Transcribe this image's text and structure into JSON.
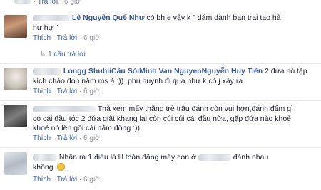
{
  "comments": [
    {
      "meta": {
        "reply_label": "Trả lời",
        "time": "6 giờ"
      }
    },
    {
      "author": "Lê Nguyễn Quế Như",
      "text_line1": " có bh e vậy k \" dám dành bạn trai tao hả",
      "text_line2": "hự hự \"",
      "meta": {
        "like_label": "Thích",
        "reply_label": "Trả lời",
        "time": "6 giờ"
      },
      "replies_label": "1 câu trả lời"
    },
    {
      "author": "Longg ShubiiCâu SóiMinh Van NguyenNguyễn Huy Tiến",
      "text_line1": " 2 đứa nó tập",
      "text_line2": "kích chào đón năm ms à :)). phụ huynh đi qua như k có j xảy ra",
      "meta": {
        "like_label": "Thích",
        "reply_label": "Trả lời",
        "time": "6 giờ"
      }
    },
    {
      "text_line1": "Thả xem mấy thằng trẻ trâu đánh còn vui hơn,đánh đấm gì",
      "text_line2": "có cái đầu tóc 2 đứa giật khang lại còn cúi cúi cái đầu nữa, gặp đứa nào khoẻ",
      "text_line3": "khoẻ nó lên gối cái nằm đồng :))",
      "meta": {
        "like_label": "Thích",
        "reply_label": "Trả lời",
        "time": "6 giờ"
      }
    },
    {
      "text_line1": "Nhận ra 1 điều là lil toàn đăng mấy con ở",
      "text_line1_end": "đánh nhau",
      "text_line2": "không.",
      "meta": {
        "like_label": "Thích",
        "reply_label": "Trả lời",
        "time": "6 giờ"
      }
    }
  ],
  "icons": {
    "reply": "reply-arrow-icon",
    "emoji": "smile-emoji-icon"
  },
  "colors": {
    "name": "#365899",
    "meta": "#90949c",
    "link": "#4267b2",
    "text": "#1d2129"
  }
}
